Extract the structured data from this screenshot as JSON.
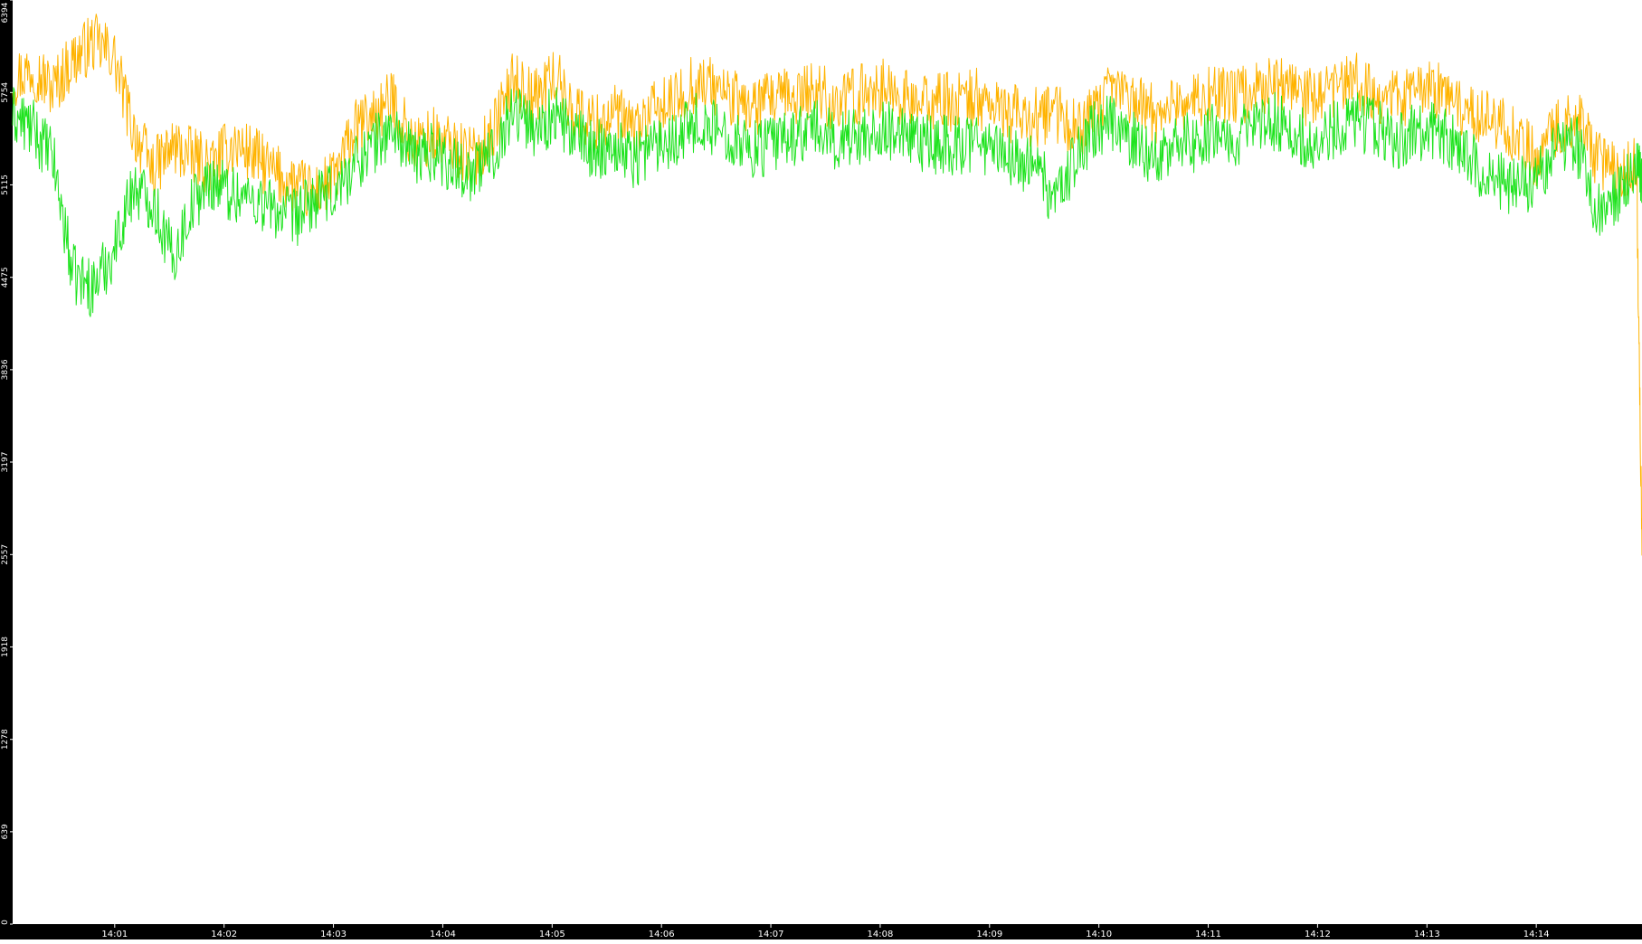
{
  "chart_data": {
    "type": "line",
    "title": "",
    "xlabel": "",
    "ylabel": "",
    "ylim": [
      0,
      6394
    ],
    "ytick_labels": [
      "0",
      "639",
      "1278",
      "1918",
      "2557",
      "3197",
      "3836",
      "4475",
      "5115",
      "5754",
      "6394"
    ],
    "xlim": [
      "14:00:04",
      "14:14:58"
    ],
    "xtick_labels": [
      "14:01",
      "14:02",
      "14:03",
      "14:04",
      "14:05",
      "14:06",
      "14:07",
      "14:08",
      "14:09",
      "14:10",
      "14:11",
      "14:12",
      "14:13",
      "14:14"
    ],
    "grid": false,
    "legend": "none",
    "background": "#ffffff",
    "frame_color": "#000000",
    "series": [
      {
        "color": "#ffb300",
        "x": [
          "14:00:04",
          "14:00:15",
          "14:00:26",
          "14:00:37",
          "14:00:48",
          "14:00:59",
          "14:01:10",
          "14:01:21",
          "14:01:32",
          "14:01:43",
          "14:01:54",
          "14:02:05",
          "14:02:16",
          "14:02:27",
          "14:02:38",
          "14:02:49",
          "14:03:00",
          "14:03:11",
          "14:03:22",
          "14:03:33",
          "14:03:44",
          "14:03:55",
          "14:04:06",
          "14:04:17",
          "14:04:28",
          "14:04:39",
          "14:04:50",
          "14:05:01",
          "14:05:12",
          "14:05:23",
          "14:05:34",
          "14:05:45",
          "14:05:56",
          "14:06:07",
          "14:06:18",
          "14:06:29",
          "14:06:40",
          "14:06:51",
          "14:07:02",
          "14:07:13",
          "14:07:24",
          "14:07:35",
          "14:07:46",
          "14:07:57",
          "14:08:08",
          "14:08:19",
          "14:08:30",
          "14:08:41",
          "14:08:52",
          "14:09:03",
          "14:09:14",
          "14:09:25",
          "14:09:36",
          "14:09:47",
          "14:09:58",
          "14:10:09",
          "14:10:20",
          "14:10:31",
          "14:10:42",
          "14:10:53",
          "14:11:04",
          "14:11:15",
          "14:11:26",
          "14:11:37",
          "14:11:48",
          "14:11:59",
          "14:12:10",
          "14:12:21",
          "14:12:32",
          "14:12:43",
          "14:12:54",
          "14:13:05",
          "14:13:16",
          "14:13:27",
          "14:13:38",
          "14:13:49",
          "14:14:00",
          "14:14:11",
          "14:14:22",
          "14:14:33",
          "14:14:44",
          "14:14:55",
          "14:14:58"
        ],
        "values": [
          5850,
          5920,
          5780,
          5980,
          6100,
          6020,
          5500,
          5220,
          5380,
          5300,
          5250,
          5400,
          5320,
          5200,
          5120,
          5050,
          5150,
          5480,
          5600,
          5700,
          5380,
          5450,
          5380,
          5300,
          5500,
          5850,
          5700,
          5880,
          5620,
          5550,
          5600,
          5500,
          5620,
          5680,
          5820,
          5800,
          5700,
          5650,
          5700,
          5720,
          5780,
          5680,
          5720,
          5800,
          5750,
          5660,
          5700,
          5680,
          5720,
          5650,
          5600,
          5580,
          5620,
          5500,
          5600,
          5800,
          5700,
          5600,
          5700,
          5680,
          5750,
          5720,
          5780,
          5820,
          5750,
          5700,
          5780,
          5820,
          5760,
          5700,
          5750,
          5780,
          5680,
          5600,
          5560,
          5450,
          5300,
          5500,
          5600,
          5300,
          5200,
          5250,
          2550
        ]
      },
      {
        "color": "#1ee31e",
        "x": [
          "14:00:04",
          "14:00:15",
          "14:00:26",
          "14:00:37",
          "14:00:48",
          "14:00:59",
          "14:01:10",
          "14:01:21",
          "14:01:32",
          "14:01:43",
          "14:01:54",
          "14:02:05",
          "14:02:16",
          "14:02:27",
          "14:02:38",
          "14:02:49",
          "14:03:00",
          "14:03:11",
          "14:03:22",
          "14:03:33",
          "14:03:44",
          "14:03:55",
          "14:04:06",
          "14:04:17",
          "14:04:28",
          "14:04:39",
          "14:04:50",
          "14:05:01",
          "14:05:12",
          "14:05:23",
          "14:05:34",
          "14:05:45",
          "14:05:56",
          "14:06:07",
          "14:06:18",
          "14:06:29",
          "14:06:40",
          "14:06:51",
          "14:07:02",
          "14:07:13",
          "14:07:24",
          "14:07:35",
          "14:07:46",
          "14:07:57",
          "14:08:08",
          "14:08:19",
          "14:08:30",
          "14:08:41",
          "14:08:52",
          "14:09:03",
          "14:09:14",
          "14:09:25",
          "14:09:36",
          "14:09:47",
          "14:09:58",
          "14:10:09",
          "14:10:20",
          "14:10:31",
          "14:10:42",
          "14:10:53",
          "14:11:04",
          "14:11:15",
          "14:11:26",
          "14:11:37",
          "14:11:48",
          "14:11:59",
          "14:12:10",
          "14:12:21",
          "14:12:32",
          "14:12:43",
          "14:12:54",
          "14:13:05",
          "14:13:16",
          "14:13:27",
          "14:13:38",
          "14:13:49",
          "14:14:00",
          "14:14:11",
          "14:14:22",
          "14:14:33",
          "14:14:44",
          "14:14:55",
          "14:14:58"
        ],
        "values": [
          5600,
          5500,
          5300,
          4500,
          4400,
          4650,
          5100,
          5000,
          4600,
          5000,
          5150,
          5050,
          5020,
          4950,
          4880,
          5000,
          5050,
          5250,
          5400,
          5500,
          5300,
          5350,
          5250,
          5200,
          5350,
          5650,
          5500,
          5600,
          5450,
          5350,
          5400,
          5300,
          5400,
          5450,
          5550,
          5500,
          5450,
          5350,
          5400,
          5450,
          5500,
          5420,
          5450,
          5500,
          5480,
          5380,
          5400,
          5380,
          5420,
          5350,
          5300,
          5250,
          5000,
          5300,
          5500,
          5550,
          5400,
          5300,
          5420,
          5400,
          5500,
          5450,
          5500,
          5550,
          5480,
          5400,
          5500,
          5550,
          5500,
          5420,
          5480,
          5500,
          5380,
          5250,
          5150,
          5100,
          5150,
          5350,
          5400,
          4950,
          5050,
          5250,
          5150
        ]
      }
    ]
  }
}
